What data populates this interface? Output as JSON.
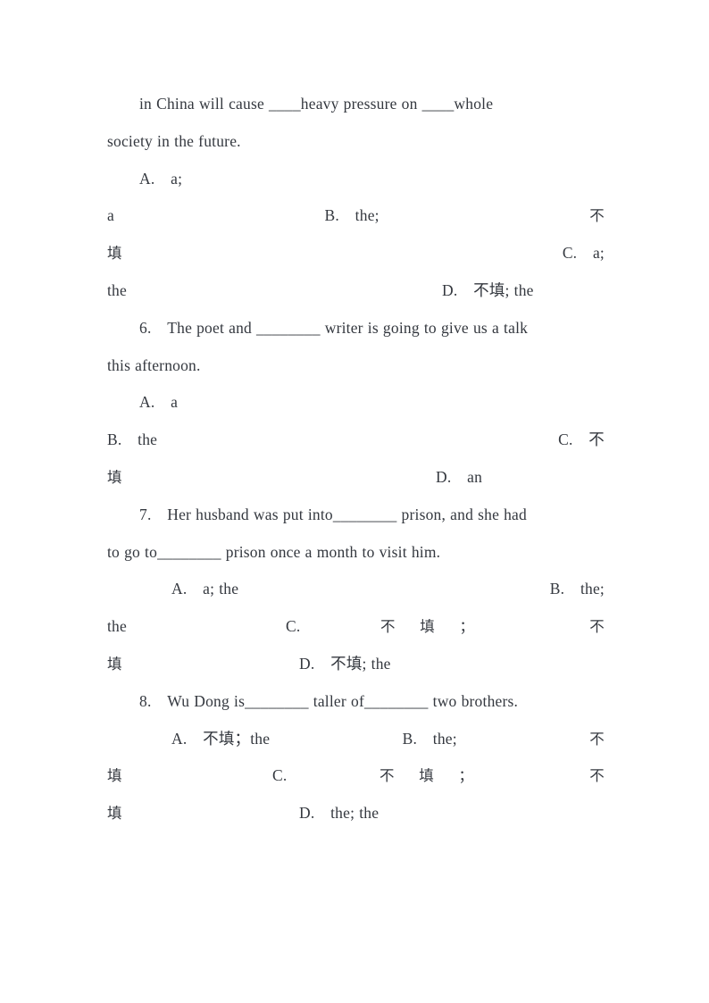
{
  "document": {
    "page_background": "#ffffff",
    "text_color": "#34383f",
    "blank_placeholder": "______",
    "blank_placeholder_short": "____",
    "cjk_no_fill": "不填"
  },
  "content": {
    "q5_continuation": {
      "stem_text": "in China will cause ____heavy pressure on ____whole society in the future.",
      "stem_line_1": "in  China  will  cause  ____heavy  pressure  on  ____whole",
      "stem_line_2": "society in the future.",
      "options_text": "A.  a; a          B.  the;  不填          C.  a; the          D.  不填; the",
      "options": [
        {
          "letter": "A.",
          "value": "a; a"
        },
        {
          "letter": "B.",
          "value": "the; 不填"
        },
        {
          "letter": "C.",
          "value": "a; the"
        },
        {
          "letter": "D.",
          "value": "不填; the"
        }
      ]
    },
    "q6": {
      "number": "6.",
      "stem_text": "The poet and ________ writer is going to give us a talk this afternoon.",
      "stem_line_1": "6.　The poet and ________ writer is going to give us a talk",
      "stem_line_2": "this afternoon.",
      "options_text": "A.  a          B.  the          C.  不填          D.  an",
      "options": [
        {
          "letter": "A.",
          "value": "a"
        },
        {
          "letter": "B.",
          "value": "the"
        },
        {
          "letter": "C.",
          "value": "不填"
        },
        {
          "letter": "D.",
          "value": "an"
        }
      ]
    },
    "q7": {
      "number": "7.",
      "stem_text": "Her husband was put into________ prison, and she had to go to________ prison once a month to visit him.",
      "stem_line_1": "7.　Her husband was put into________ prison, and she had",
      "stem_line_2": "to go to________ prison once a month to visit him.",
      "options_text": "A.  a; the          B.  the; the          C.  不填；不填          D.  不填; the",
      "options": [
        {
          "letter": "A.",
          "value": "a; the"
        },
        {
          "letter": "B.",
          "value": "the; the"
        },
        {
          "letter": "C.",
          "value": "不填；不填"
        },
        {
          "letter": "D.",
          "value": "不填; the"
        }
      ]
    },
    "q8": {
      "number": "8.",
      "stem_text": "Wu Dong is________ taller of________ two brothers.",
      "stem_line_1": "8.　Wu Dong is________ taller of________ two brothers.",
      "options_text": "A.  不填；the          B.  the; 不填          C.  不填；不填          D.  the; the",
      "options": [
        {
          "letter": "A.",
          "value": "不填；the"
        },
        {
          "letter": "B.",
          "value": "the; 不填"
        },
        {
          "letter": "C.",
          "value": "不填；不填"
        },
        {
          "letter": "D.",
          "value": "the; the"
        }
      ]
    }
  },
  "rendered_lines": {
    "l1": "in  China  will  cause  ____heavy  pressure  on  ____whole",
    "l2": "society in the future.",
    "l3_left": "A.　a;",
    "l4_left": "a",
    "l4_right": "B.　the;",
    "l4_far": "不",
    "l5_left": "填",
    "l5_right": "C.　a;",
    "l6_left": "the",
    "l6_right": "D.　不填; the",
    "l7": "6.　The poet and ________ writer is going to give us a talk",
    "l8": "this afternoon.",
    "l9_left": "A.　a",
    "l10_left": "B.　the",
    "l10_far": "C.　不",
    "l11_left": "填",
    "l11_right": "D.　an",
    "l12": "7.　Her husband was put into________ prison, and she had",
    "l13": "to go to________ prison once a month to visit him.",
    "l14_left": "A.　a; the",
    "l14_right": "B.　the;",
    "l15_left": "the",
    "l15_mid": "C.",
    "l15_cjk": "不 填 ；",
    "l15_far": "不",
    "l16_left": "填",
    "l16_right": "D.　不填; the",
    "l17": "8.　Wu Dong is________ taller of________ two brothers.",
    "l18_left": "A.　不填；the",
    "l18_right": "B.　the;",
    "l18_far": "不",
    "l19_left": "填",
    "l19_mid": "C.",
    "l19_cjk": "不 填 ；",
    "l19_far": "不",
    "l20_left": "填",
    "l20_right": "D.　the; the"
  }
}
